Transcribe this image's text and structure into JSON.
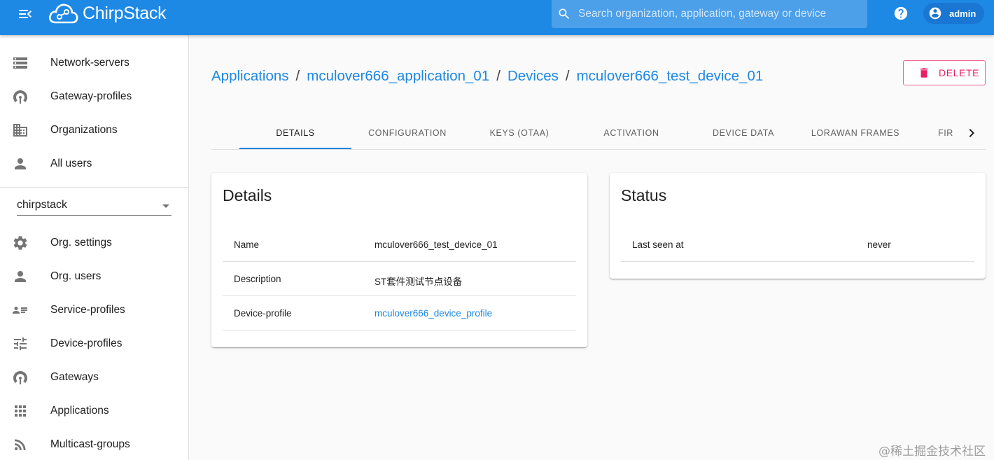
{
  "topbar": {
    "app_name": "ChirpStack",
    "search_placeholder": "Search organization, application, gateway or device",
    "user_name": "admin",
    "bg_color": "#1e88e5"
  },
  "sidebar": {
    "global_items": [
      {
        "label": "Network-servers",
        "icon": "server-icon"
      },
      {
        "label": "Gateway-profiles",
        "icon": "broadcast-icon"
      },
      {
        "label": "Organizations",
        "icon": "building-icon"
      },
      {
        "label": "All users",
        "icon": "person-icon"
      }
    ],
    "org_select_value": "chirpstack",
    "org_items": [
      {
        "label": "Org. settings",
        "icon": "gear-icon"
      },
      {
        "label": "Org. users",
        "icon": "person-icon"
      },
      {
        "label": "Service-profiles",
        "icon": "people-list-icon"
      },
      {
        "label": "Device-profiles",
        "icon": "sliders-icon"
      },
      {
        "label": "Gateways",
        "icon": "broadcast-icon"
      },
      {
        "label": "Applications",
        "icon": "apps-grid-icon"
      },
      {
        "label": "Multicast-groups",
        "icon": "rss-icon"
      }
    ]
  },
  "breadcrumb": {
    "items": [
      "Applications",
      "mculover666_application_01",
      "Devices",
      "mculover666_test_device_01"
    ],
    "separator": "/"
  },
  "delete_button": {
    "label": "DELETE",
    "color": "#e91e63"
  },
  "tabs": {
    "items": [
      "DETAILS",
      "CONFIGURATION",
      "KEYS (OTAA)",
      "ACTIVATION",
      "DEVICE DATA",
      "LORAWAN FRAMES",
      "FIR"
    ],
    "active": "DETAILS"
  },
  "details_card": {
    "title": "Details",
    "rows": [
      {
        "key": "Name",
        "value": "mculover666_test_device_01"
      },
      {
        "key": "Description",
        "value": "ST套件测试节点设备"
      },
      {
        "key": "Device-profile",
        "value": "mculover666_device_profile"
      }
    ]
  },
  "status_card": {
    "title": "Status",
    "rows": [
      {
        "key": "Last seen at",
        "value": "never"
      }
    ]
  },
  "watermark": "@稀土掘金技术社区"
}
